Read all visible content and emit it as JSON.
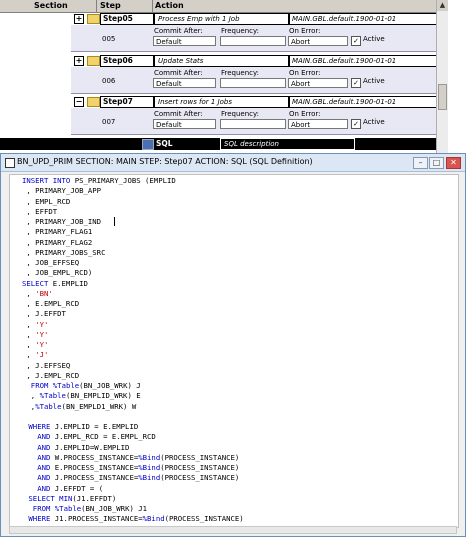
{
  "grid": {
    "columns": [
      "Section",
      "Step",
      "Action"
    ],
    "steps": [
      {
        "toggle": "+",
        "name": "Step05",
        "description": "Process Emp with 1 Job",
        "market": "MAIN.GBL.default.1900-01-01",
        "number": "005",
        "commit_after_label": "Commit After:",
        "frequency_label": "Frequency:",
        "on_error_label": "On Error:",
        "commit_after": "Default",
        "frequency": "",
        "on_error": "Abort",
        "active_check": "✓",
        "active_label": "Active"
      },
      {
        "toggle": "+",
        "name": "Step06",
        "description": "Update Stats",
        "market": "MAIN.GBL.default.1900-01-01",
        "number": "006",
        "commit_after_label": "Commit After:",
        "frequency_label": "Frequency:",
        "on_error_label": "On Error:",
        "commit_after": "Default",
        "frequency": "",
        "on_error": "Abort",
        "active_check": "✓",
        "active_label": "Active"
      },
      {
        "toggle": "−",
        "name": "Step07",
        "description": "Insert rows for 1 Jobs",
        "market": "MAIN.GBL.default.1900-01-01",
        "number": "007",
        "commit_after_label": "Commit After:",
        "frequency_label": "Frequency:",
        "on_error_label": "On Error:",
        "commit_after": "Default",
        "frequency": "",
        "on_error": "Abort",
        "active_check": "✓",
        "active_label": "Active"
      }
    ],
    "sql_row": {
      "label": "SQL",
      "description": "SQL description"
    }
  },
  "window": {
    "title": "BN_UPD_PRIM  SECTION: MAIN  STEP: Step07  ACTION: SQL  (SQL Definition)",
    "minimize": "–",
    "maximize": "□",
    "close": "✕"
  },
  "sql_lines": [
    [
      {
        "t": "INSERT INTO",
        "c": "kw"
      },
      {
        "t": " PS_PRIMARY_JOBS (EMPLID"
      }
    ],
    [
      {
        "t": " , PRIMARY_JOB_APP"
      }
    ],
    [
      {
        "t": " , EMPL_RCD"
      }
    ],
    [
      {
        "t": " , EFFDT"
      }
    ],
    [
      {
        "t": " , PRIMARY_JOB_IND"
      }
    ],
    [
      {
        "t": " , PRIMARY_FLAG1"
      }
    ],
    [
      {
        "t": " , PRIMARY_FLAG2"
      }
    ],
    [
      {
        "t": " , PRIMARY_JOBS_SRC"
      }
    ],
    [
      {
        "t": " , JOB_EFFSEQ"
      }
    ],
    [
      {
        "t": " , JOB_EMPL_RCD)"
      }
    ],
    [
      {
        "t": "SELECT",
        "c": "kw"
      },
      {
        "t": " E.EMPLID"
      }
    ],
    [
      {
        "t": " , "
      },
      {
        "t": "'BN'",
        "c": "st"
      }
    ],
    [
      {
        "t": " , E.EMPL_RCD"
      }
    ],
    [
      {
        "t": " , J.EFFDT"
      }
    ],
    [
      {
        "t": " , "
      },
      {
        "t": "'Y'",
        "c": "st"
      }
    ],
    [
      {
        "t": " , "
      },
      {
        "t": "'Y'",
        "c": "st"
      }
    ],
    [
      {
        "t": " , "
      },
      {
        "t": "'Y'",
        "c": "st"
      }
    ],
    [
      {
        "t": " , "
      },
      {
        "t": "'J'",
        "c": "st"
      }
    ],
    [
      {
        "t": " , J.EFFSEQ"
      }
    ],
    [
      {
        "t": " , J.EMPL_RCD"
      }
    ],
    [
      {
        "t": "  "
      },
      {
        "t": "FROM",
        "c": "kw"
      },
      {
        "t": " "
      },
      {
        "t": "%Table",
        "c": "kw"
      },
      {
        "t": "(BN_JOB_WRK) J"
      }
    ],
    [
      {
        "t": "  , "
      },
      {
        "t": "%Table",
        "c": "kw"
      },
      {
        "t": "(BN_EMPLID_WRK) E"
      }
    ],
    [
      {
        "t": "  ,"
      },
      {
        "t": "%Table",
        "c": "kw"
      },
      {
        "t": "(BN_EMPLD1_WRK) W"
      }
    ],
    [
      {
        "t": ""
      }
    ],
    [
      {
        "t": " "
      },
      {
        "t": "WHERE",
        "c": "kw"
      },
      {
        "t": " J.EMPLID = E.EMPLID"
      }
    ],
    [
      {
        "t": "   "
      },
      {
        "t": "AND",
        "c": "kw"
      },
      {
        "t": " J.EMPL_RCD = E.EMPL_RCD"
      }
    ],
    [
      {
        "t": "   "
      },
      {
        "t": "AND",
        "c": "kw"
      },
      {
        "t": " J.EMPLID=W.EMPLID"
      }
    ],
    [
      {
        "t": "   "
      },
      {
        "t": "AND",
        "c": "kw"
      },
      {
        "t": " W.PROCESS_INSTANCE="
      },
      {
        "t": "%Bind",
        "c": "kw"
      },
      {
        "t": "(PROCESS_INSTANCE)"
      }
    ],
    [
      {
        "t": "   "
      },
      {
        "t": "AND",
        "c": "kw"
      },
      {
        "t": " E.PROCESS_INSTANCE="
      },
      {
        "t": "%Bind",
        "c": "kw"
      },
      {
        "t": "(PROCESS_INSTANCE)"
      }
    ],
    [
      {
        "t": "   "
      },
      {
        "t": "AND",
        "c": "kw"
      },
      {
        "t": " J.PROCESS_INSTANCE="
      },
      {
        "t": "%Bind",
        "c": "kw"
      },
      {
        "t": "(PROCESS_INSTANCE)"
      }
    ],
    [
      {
        "t": "   "
      },
      {
        "t": "AND",
        "c": "kw"
      },
      {
        "t": " J.EFFDT = ("
      }
    ],
    [
      {
        "t": " "
      },
      {
        "t": "SELECT",
        "c": "kw"
      },
      {
        "t": " "
      },
      {
        "t": "MIN",
        "c": "kw"
      },
      {
        "t": "(J1.EFFDT)"
      }
    ],
    [
      {
        "t": "  "
      },
      {
        "t": "FROM",
        "c": "kw"
      },
      {
        "t": " "
      },
      {
        "t": "%Table",
        "c": "kw"
      },
      {
        "t": "(BN_JOB_WRK) J1"
      }
    ],
    [
      {
        "t": " "
      },
      {
        "t": "WHERE",
        "c": "kw"
      },
      {
        "t": " J1.PROCESS_INSTANCE="
      },
      {
        "t": "%Bind",
        "c": "kw"
      },
      {
        "t": "(PROCESS_INSTANCE)"
      }
    ]
  ],
  "colors": {
    "keyword": "#0000c8",
    "string": "#c00000",
    "sql_row_bg": "#000000",
    "titlebar_bg": "#dbe7f4"
  }
}
